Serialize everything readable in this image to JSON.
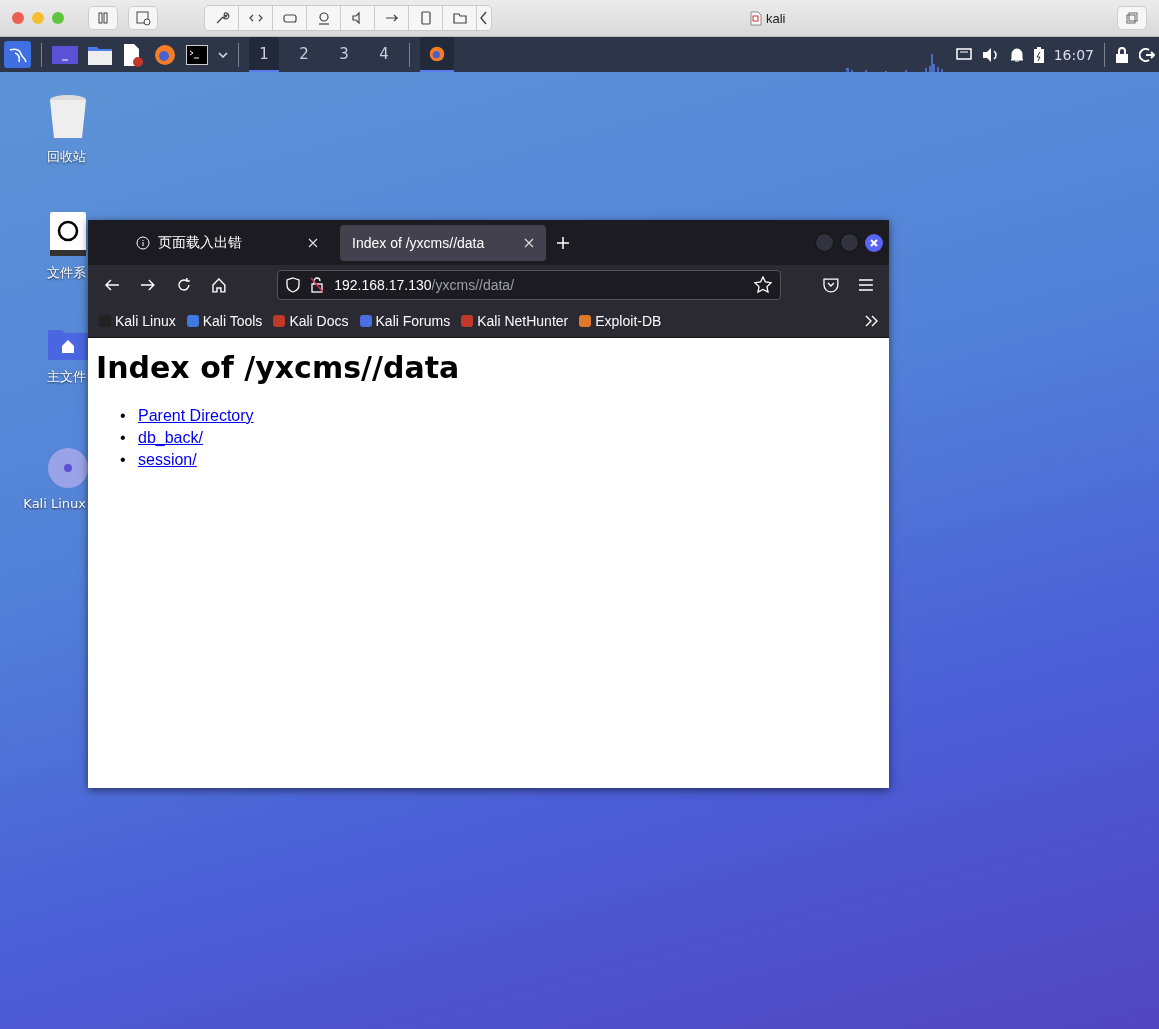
{
  "host_window": {
    "title": "kali"
  },
  "panel": {
    "workspaces": [
      {
        "label": "1",
        "selected": true
      },
      {
        "label": "2",
        "selected": false
      },
      {
        "label": "3",
        "selected": false
      },
      {
        "label": "4",
        "selected": false
      }
    ],
    "clock": "16:07"
  },
  "desktop_icons": [
    {
      "label": "回收站",
      "kind": "trash"
    },
    {
      "label": "文件系",
      "kind": "drive"
    },
    {
      "label": "主文件",
      "kind": "home"
    },
    {
      "label": "Kali Linux",
      "kind": "disc"
    }
  ],
  "browser": {
    "tabs": [
      {
        "title": "页面载入出错",
        "kind": "error",
        "selected": false
      },
      {
        "title": "Index of /yxcms//data",
        "kind": "page",
        "selected": true
      }
    ],
    "url": {
      "host": "192.168.17.130",
      "path": "/yxcms//data/"
    },
    "bookmarks": [
      "Kali Linux",
      "Kali Tools",
      "Kali Docs",
      "Kali Forums",
      "Kali NetHunter",
      "Exploit-DB"
    ],
    "page": {
      "heading": "Index of /yxcms//data",
      "links": [
        {
          "bullet": "•",
          "text": "Parent Directory"
        },
        {
          "bullet": "•",
          "text": "db_back/"
        },
        {
          "bullet": "•",
          "text": "session/"
        }
      ]
    }
  }
}
